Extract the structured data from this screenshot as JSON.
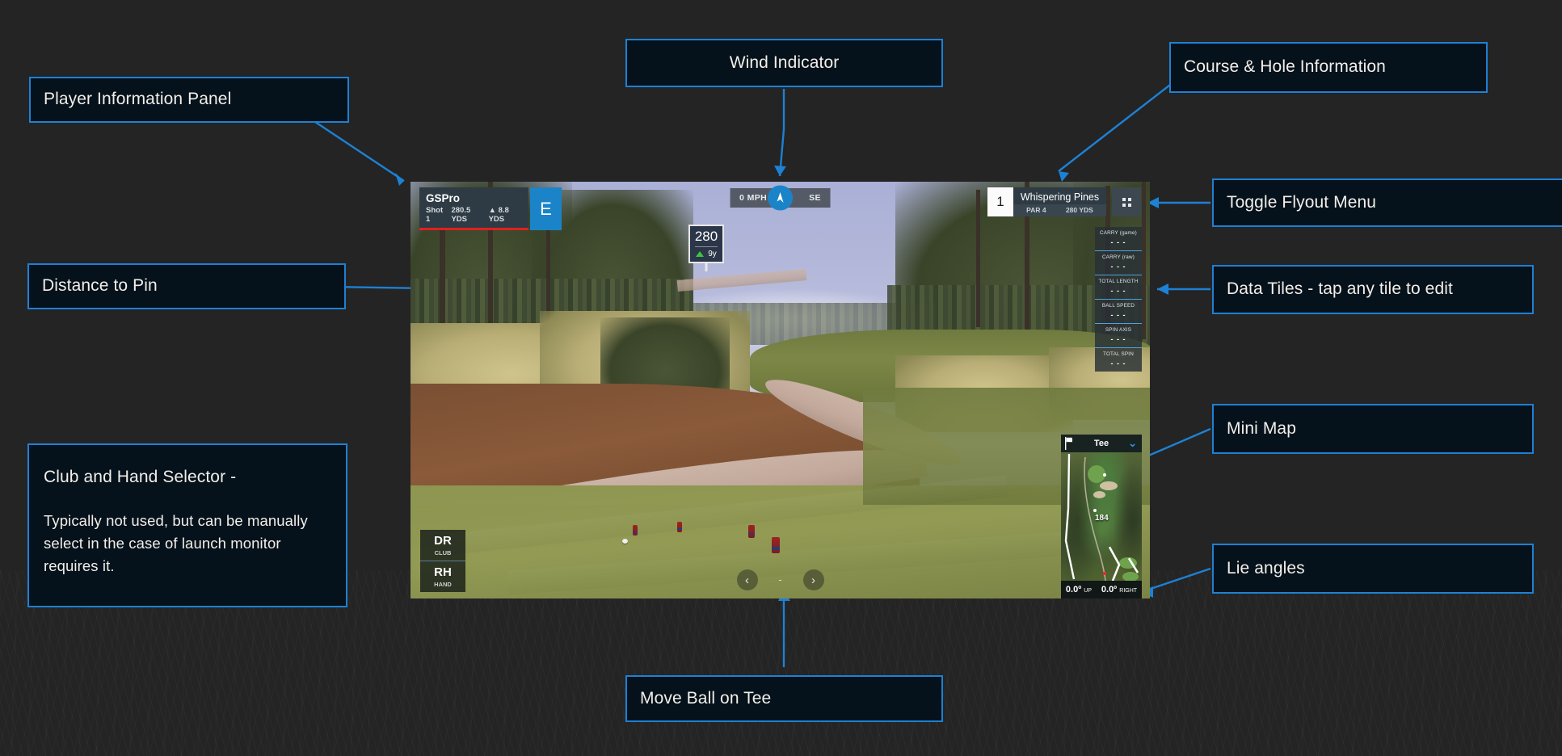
{
  "annotations": [
    {
      "id": "player-information-panel",
      "label": "Player Information Panel"
    },
    {
      "id": "wind-indicator",
      "label": "Wind Indicator"
    },
    {
      "id": "course-hole-information",
      "label": "Course & Hole Information"
    },
    {
      "id": "toggle-flyout-menu",
      "label": "Toggle Flyout Menu"
    },
    {
      "id": "distance-to-pin",
      "label": "Distance to Pin"
    },
    {
      "id": "data-tiles",
      "label": "Data Tiles - tap any tile to edit"
    },
    {
      "id": "mini-map",
      "label": "Mini Map"
    },
    {
      "id": "lie-angles",
      "label": "Lie angles"
    },
    {
      "id": "move-ball-on-tee",
      "label": "Move Ball on Tee"
    },
    {
      "id": "club-and-hand-selector",
      "title": "Club and Hand Selector -",
      "body": "Typically not used, but can be manually select in the case of launch monitor requires it."
    }
  ],
  "accent_color": "#1d81d4",
  "callout_bg": "#05111b",
  "game": {
    "player_panel": {
      "name": "GSPro",
      "shot": "Shot 1",
      "distance": "280.5 YDS",
      "elevation": "▲ 8.8 YDS",
      "score_badge": "E",
      "underline_color": "#e02020"
    },
    "wind": {
      "speed": "0 MPH",
      "direction": "SE",
      "dial_icon": "wind-arrow-icon",
      "dial_color": "#1b84c8"
    },
    "course": {
      "hole_number": "1",
      "name": "Whispering Pines",
      "par": "PAR 4",
      "length": "280 YDS",
      "flyout_icon": "grid-dots-icon"
    },
    "distance_marker": {
      "value": "280",
      "elevation": "9y",
      "elevation_icon": "triangle-up-icon",
      "elevation_color": "#3cc63c"
    },
    "data_tiles": [
      {
        "label": "CARRY (game)",
        "value": "- - -"
      },
      {
        "label": "CARRY (raw)",
        "value": "- - -"
      },
      {
        "label": "TOTAL LENGTH",
        "value": "- - -"
      },
      {
        "label": "BALL SPEED",
        "value": "- - -"
      },
      {
        "label": "SPIN AXIS",
        "value": "- - -"
      },
      {
        "label": "TOTAL SPIN",
        "value": "- - -"
      }
    ],
    "minimap": {
      "title": "Tee",
      "flag_icon": "flag-icon",
      "chevron_icon": "chevron-down-icon",
      "distance_label": "184",
      "lie_up": "0.0º",
      "lie_up_label": "UP",
      "lie_right": "0.0º",
      "lie_right_label": "RIGHT"
    },
    "club_hand": {
      "club_value": "DR",
      "club_label": "CLUB",
      "hand_value": "RH",
      "hand_label": "HAND"
    },
    "tee_controls": {
      "prev_icon": "‹",
      "next_icon": "›",
      "ball_marker": "-"
    }
  }
}
